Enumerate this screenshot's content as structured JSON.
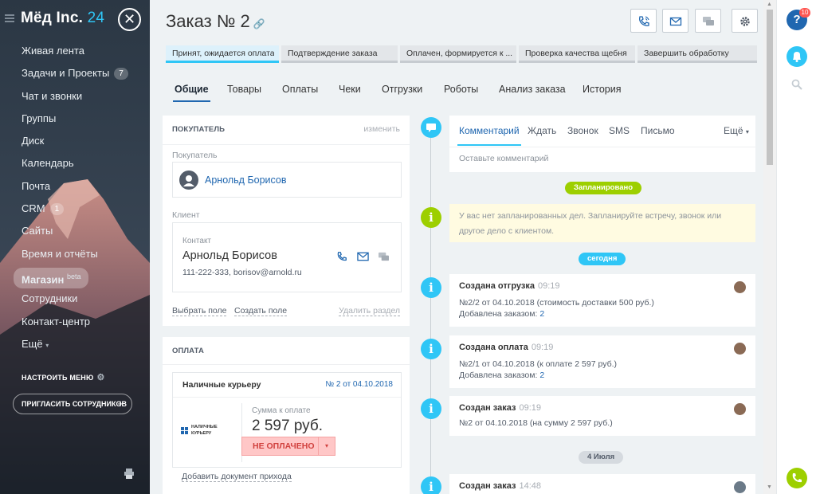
{
  "app": {
    "logo_main": "Мёд Inc.",
    "logo_num": "24"
  },
  "sidebar": {
    "items": [
      {
        "label": "Живая лента"
      },
      {
        "label": "Задачи и Проекты",
        "count": "7"
      },
      {
        "label": "Чат и звонки"
      },
      {
        "label": "Группы"
      },
      {
        "label": "Диск"
      },
      {
        "label": "Календарь"
      },
      {
        "label": "Почта"
      },
      {
        "label": "CRM",
        "count": "1"
      },
      {
        "label": "Сайты"
      },
      {
        "label": "Время и отчёты"
      },
      {
        "label": "Магазин",
        "sup": "beta"
      },
      {
        "label": "Сотрудники"
      },
      {
        "label": "Контакт-центр"
      },
      {
        "label": "Ещё"
      }
    ],
    "settings_label": "НАСТРОИТЬ МЕНЮ",
    "invite_label": "ПРИГЛАСИТЬ СОТРУДНИКОВ",
    "invite_plus": "+"
  },
  "header": {
    "title": "Заказ № 2"
  },
  "stages": [
    {
      "label": "Принят, ожидается оплата"
    },
    {
      "label": "Подтверждение заказа"
    },
    {
      "label": "Оплачен, формируется к ..."
    },
    {
      "label": "Проверка качества щебня"
    },
    {
      "label": "Завершить обработку"
    }
  ],
  "tabs": [
    {
      "label": "Общие"
    },
    {
      "label": "Товары"
    },
    {
      "label": "Оплаты"
    },
    {
      "label": "Чеки"
    },
    {
      "label": "Отгрузки"
    },
    {
      "label": "Роботы"
    },
    {
      "label": "Анализ заказа"
    },
    {
      "label": "История"
    }
  ],
  "buyer": {
    "section_title": "ПОКУПАТЕЛЬ",
    "edit": "изменить",
    "buyer_label": "Покупатель",
    "buyer_name": "Арнольд Борисов",
    "client_label": "Клиент",
    "contact_label": "Контакт",
    "contact_name": "Арнольд Борисов",
    "contact_info": "111-222-333, borisov@arnold.ru",
    "select_field": "Выбрать поле",
    "create_field": "Создать поле",
    "delete_section": "Удалить раздел"
  },
  "payment": {
    "section_title": "ОПЛАТА",
    "method": "Наличные курьеру",
    "doc_link": "№ 2 от 04.10.2018",
    "logo_text_1": "НАЛИЧНЫЕ",
    "logo_text_2": "КУРЬЕРУ",
    "sum_label": "Сумма к оплате",
    "sum": "2 597 руб.",
    "status": "НЕ ОПЛАЧЕНО",
    "add_doc": "Добавить документ прихода"
  },
  "activity": {
    "tabs": [
      {
        "label": "Комментарий"
      },
      {
        "label": "Ждать"
      },
      {
        "label": "Звонок"
      },
      {
        "label": "SMS"
      },
      {
        "label": "Письмо"
      }
    ],
    "more": "Ещё",
    "placeholder": "Оставьте комментарий",
    "planned_badge": "Запланировано",
    "plan_text_1": "У вас нет запланированных дел. Запланируйте встречу, звонок или",
    "plan_text_2": "другое дело с клиентом.",
    "today_badge": "сегодня",
    "date_badge": "4 Июля"
  },
  "events": [
    {
      "title": "Создана отгрузка",
      "time": "09:19",
      "link": "№2/2 от 04.10.2018 (стоимость доставки 500 руб.)",
      "sub_prefix": "Добавлена заказом: ",
      "sub_link": "2"
    },
    {
      "title": "Создана оплата",
      "time": "09:19",
      "link": "№2/1 от 04.10.2018 (к оплате 2 597 руб.)",
      "sub_prefix": "Добавлена заказом: ",
      "sub_link": "2"
    },
    {
      "title": "Создан заказ",
      "time": "09:19",
      "text": "№2 от 04.10.2018 (на сумму 2 597 руб.)"
    },
    {
      "title": "Создан заказ",
      "time": "14:48"
    }
  ],
  "right_bar": {
    "help_badge": "10"
  },
  "colors": {
    "accent": "#2fc6f6",
    "link": "#2067b0",
    "green": "#9dcf00",
    "danger": "#d1413e"
  }
}
